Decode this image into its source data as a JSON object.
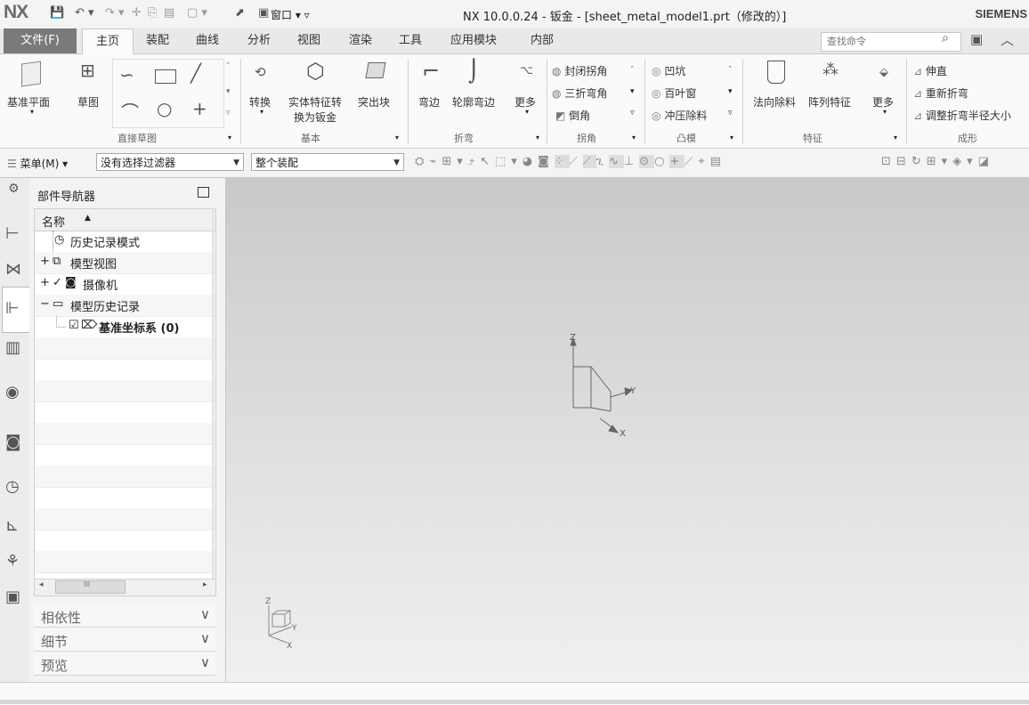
{
  "titlebar": {
    "logo": "NX",
    "window_menu": "窗口",
    "title": "NX 10.0.0.24 - 钣金 - [sheet_metal_model1.prt（修改的）]",
    "brand": "SIEMENS"
  },
  "menubar": {
    "file": "文件(F)",
    "tabs": [
      "主页",
      "装配",
      "曲线",
      "分析",
      "视图",
      "渲染",
      "工具",
      "应用模块",
      "内部"
    ],
    "active_tab": "主页",
    "search_placeholder": "查找命令"
  },
  "ribbon": {
    "datum_plane": "基准平面",
    "sketch": "草图",
    "group_direct_sketch": "直接草图",
    "convert": "转换",
    "solid_to_sheet_l1": "实体特征转",
    "solid_to_sheet_l2": "换为钣金",
    "tab_block": "突出块",
    "group_basic": "基本",
    "flange": "弯边",
    "contour_flange": "轮廓弯边",
    "more_bend": "更多",
    "group_bend": "折弯",
    "closed_corner": "封闭拐角",
    "three_bend_corner": "三折弯角",
    "chamfer": "倒角",
    "group_corner": "拐角",
    "dimple": "凹坑",
    "louver": "百叶窗",
    "drawn_cutout": "冲压除料",
    "group_emboss": "凸模",
    "normal_cutout": "法向除料",
    "pattern_feature": "阵列特征",
    "more_feature": "更多",
    "group_feature": "特征",
    "unbend": "伸直",
    "rebend": "重新折弯",
    "resize_bend_radius": "调整折弯半径大小",
    "group_form": "成形"
  },
  "toolbar2": {
    "menu": "菜单(M)",
    "selection_filter": "没有选择过滤器",
    "scope": "整个装配"
  },
  "navigator": {
    "title": "部件导航器",
    "column_name": "名称",
    "items": [
      {
        "label": "历史记录模式",
        "bold": false
      },
      {
        "label": "模型视图",
        "bold": false
      },
      {
        "label": "摄像机",
        "bold": false
      },
      {
        "label": "模型历史记录",
        "bold": false
      },
      {
        "label": "基准坐标系 (0)",
        "bold": true
      }
    ],
    "scroll_mark": "III",
    "panels": [
      "相依性",
      "细节",
      "预览"
    ]
  },
  "viewport": {
    "axis_z": "Z",
    "axis_y": "Y",
    "axis_x": "X"
  },
  "colors": {
    "file_tab": "#7a7a7a",
    "viewport_top": "#c9c9c9",
    "viewport_bottom": "#f0f0f0"
  }
}
